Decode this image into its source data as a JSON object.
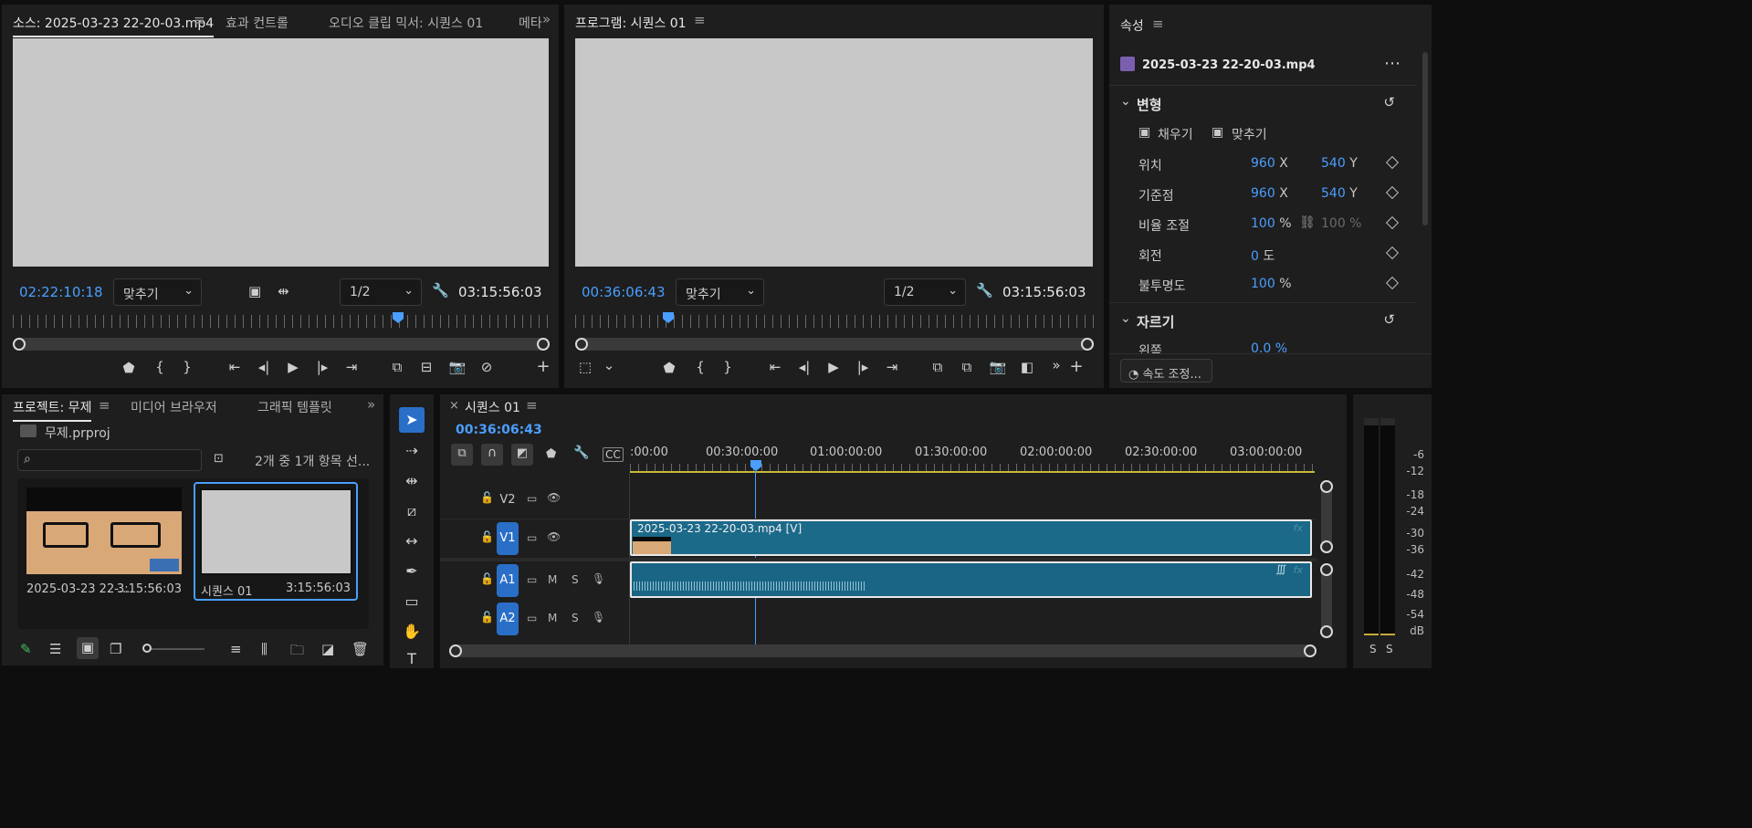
{
  "source_monitor": {
    "tabs": [
      "소스: 2025-03-23 22-20-03.mp4",
      "효과 컨트롤",
      "오디오 클립 믹서: 시퀀스 01",
      "메타"
    ],
    "timecode": "02:22:10:18",
    "fit_label": "맞추기",
    "resolution": "1/2",
    "duration": "03:15:56:03"
  },
  "program_monitor": {
    "tab": "프로그램: 시퀀스 01",
    "timecode": "00:36:06:43",
    "fit_label": "맞추기",
    "resolution": "1/2",
    "duration": "03:15:56:03"
  },
  "properties": {
    "title": "속성",
    "clip_name": "2025-03-23 22-20-03.mp4",
    "transform_section": "변형",
    "fill_label": "채우기",
    "fit_label": "맞추기",
    "rows": [
      {
        "label": "위치",
        "v1": "960",
        "u1": "X",
        "v2": "540",
        "u2": "Y"
      },
      {
        "label": "기준점",
        "v1": "960",
        "u1": "X",
        "v2": "540",
        "u2": "Y"
      },
      {
        "label": "비율 조절",
        "v1": "100",
        "u1": "%",
        "v2": "100 %",
        "u2": ""
      },
      {
        "label": "회전",
        "v1": "0",
        "u1": "도",
        "v2": "",
        "u2": ""
      },
      {
        "label": "불투명도",
        "v1": "100",
        "u1": "%",
        "v2": "",
        "u2": ""
      }
    ],
    "crop_section": "자르기",
    "crop_partial": "왼쪽",
    "crop_partial_value": "0.0 %",
    "speed_button": "속도 조정..."
  },
  "project": {
    "tabs": [
      "프로젝트: 무제",
      "미디어 브라우저",
      "그래픽 템플릿"
    ],
    "file": "무제.prproj",
    "search_placeholder": "",
    "item_count": "2개 중 1개 항목 선...",
    "items": [
      {
        "name": "2025-03-23 22-...",
        "duration": "3:15:56:03"
      },
      {
        "name": "시퀀스 01",
        "duration": "3:15:56:03"
      }
    ]
  },
  "timeline": {
    "tab": "시퀀스 01",
    "timecode": "00:36:06:43",
    "ruler_labels": [
      ":00:00",
      "00:30:00:00",
      "01:00:00:00",
      "01:30:00:00",
      "02:00:00:00",
      "02:30:00:00",
      "03:00:00:00"
    ],
    "tracks": {
      "v2": "V2",
      "v1": "V1",
      "a1": "A1",
      "a2": "A2",
      "mute": "M",
      "solo": "S"
    },
    "video_clip": "2025-03-23 22-20-03.mp4 [V]",
    "fx": "fx"
  },
  "audio_meter": {
    "scale": [
      "-6",
      "-12",
      "-18",
      "-24",
      "-30",
      "-36",
      "-42",
      "-48",
      "-54",
      "dB"
    ],
    "solo": [
      "S",
      "S"
    ]
  },
  "colors": {
    "accent": "#4a9eff",
    "clip_video": "#1c6a8a",
    "clip_audio": "#1a6585"
  }
}
